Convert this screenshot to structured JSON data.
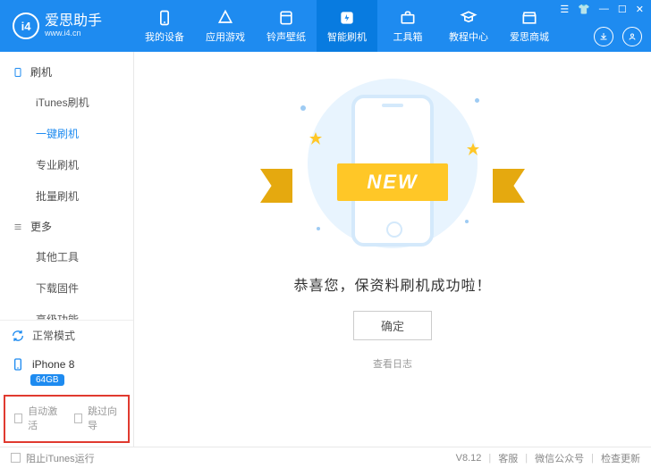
{
  "header": {
    "app_name": "爱思助手",
    "app_url": "www.i4.cn",
    "logo_text": "i4",
    "nav": [
      {
        "label": "我的设备",
        "icon": "device"
      },
      {
        "label": "应用游戏",
        "icon": "apps"
      },
      {
        "label": "铃声壁纸",
        "icon": "ringtone"
      },
      {
        "label": "智能刷机",
        "icon": "flash",
        "active": true
      },
      {
        "label": "工具箱",
        "icon": "toolbox"
      },
      {
        "label": "教程中心",
        "icon": "tutorial"
      },
      {
        "label": "爱思商城",
        "icon": "store"
      }
    ],
    "right_icons": [
      "download",
      "user"
    ]
  },
  "sidebar": {
    "groups": [
      {
        "title": "刷机",
        "icon": "flash-square",
        "items": [
          "iTunes刷机",
          "一键刷机",
          "专业刷机",
          "批量刷机"
        ],
        "active_index": 1
      },
      {
        "title": "更多",
        "icon": "menu",
        "items": [
          "其他工具",
          "下载固件",
          "高级功能"
        ]
      }
    ],
    "mode_label": "正常模式",
    "device_name": "iPhone 8",
    "device_storage": "64GB",
    "auto_activate_label": "自动激活",
    "skip_wizard_label": "跳过向导"
  },
  "main": {
    "ribbon_text": "NEW",
    "message": "恭喜您，保资料刷机成功啦！",
    "ok_button": "确定",
    "log_link": "查看日志"
  },
  "status": {
    "block_itunes": "阻止iTunes运行",
    "version": "V8.12",
    "support": "客服",
    "wechat": "微信公众号",
    "check_update": "检查更新"
  }
}
